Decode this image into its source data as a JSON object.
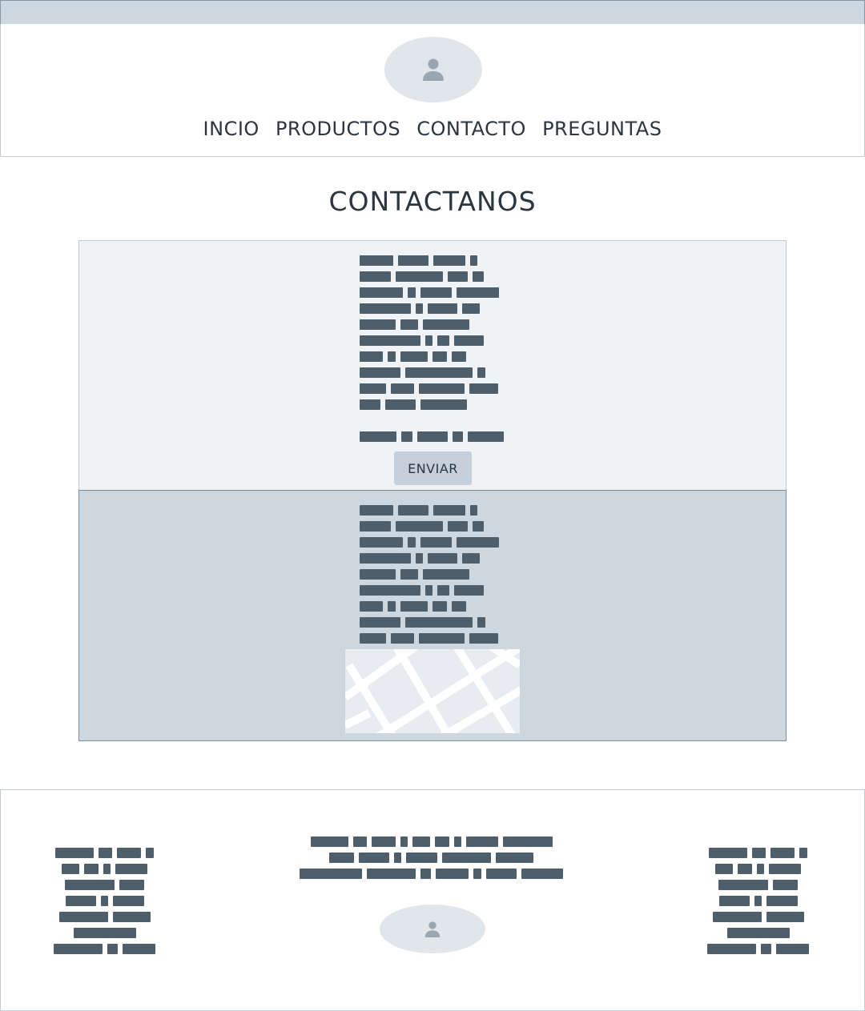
{
  "nav": {
    "items": [
      "INCIO",
      "PRODUCTOS",
      "CONTACTO",
      "PREGUNTAS"
    ]
  },
  "header": {
    "logo_icon": "user-avatar-icon"
  },
  "page": {
    "title": "CONTACTANOS"
  },
  "form": {
    "submit_label": "ENVIAR"
  },
  "map": {
    "icon": "map-placeholder"
  },
  "footer": {
    "logo_icon": "user-avatar-icon"
  },
  "colors": {
    "topbar": "#cdd7df",
    "placeholder_text": "#4f5e6b",
    "avatar_bg": "#e1e6ea",
    "form_bg": "#eff3f6",
    "info_bg": "#cdd7df"
  }
}
